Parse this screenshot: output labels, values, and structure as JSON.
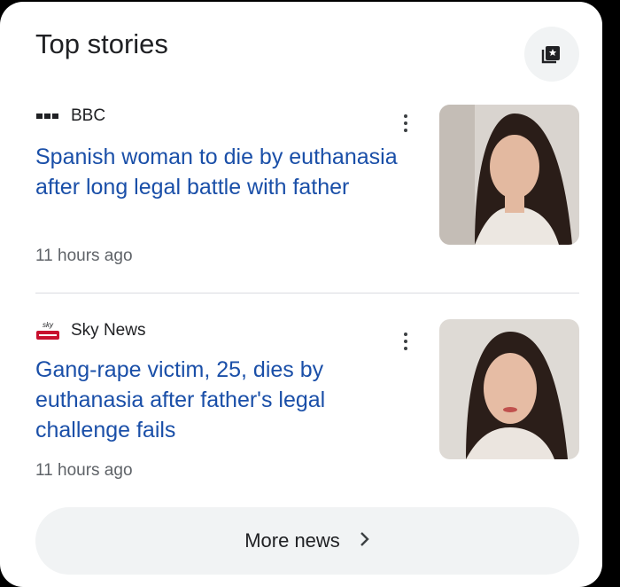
{
  "header": {
    "title": "Top stories",
    "follow_icon": "bookmark-star-icon"
  },
  "stories": [
    {
      "source": "BBC",
      "source_icon": "bbc-logo",
      "headline": "Spanish woman to die by euthanasia after long legal battle with father",
      "time": "11 hours ago",
      "menu_icon": "more-vert-icon"
    },
    {
      "source": "Sky News",
      "source_icon": "sky-news-logo",
      "headline": "Gang-rape victim, 25, dies by euthanasia after father's legal challenge fails",
      "time": "11 hours ago",
      "menu_icon": "more-vert-icon"
    }
  ],
  "footer": {
    "more_label": "More news",
    "more_icon": "chevron-right-icon"
  },
  "colors": {
    "headline": "#1a4fa8",
    "background": "#ffffff",
    "pill": "#f1f3f4"
  }
}
